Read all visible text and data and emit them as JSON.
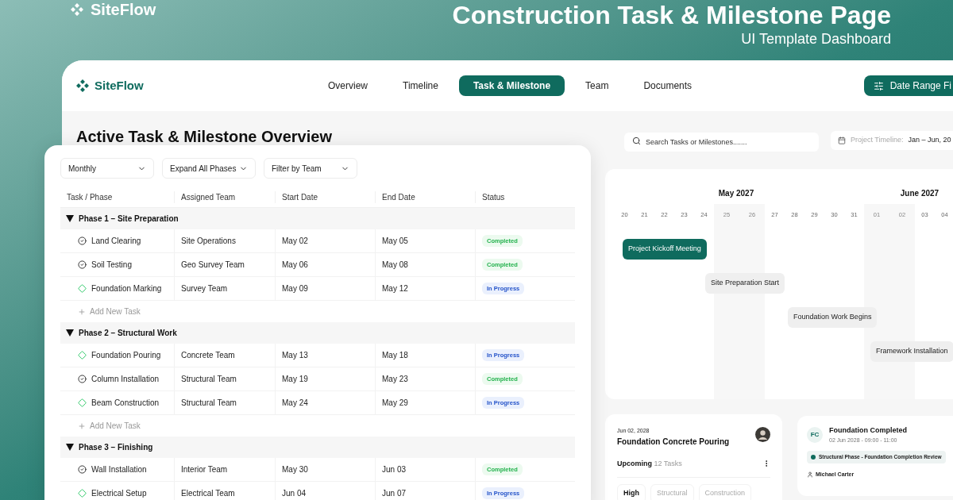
{
  "banner": {
    "brand": "SiteFlow",
    "title": "Construction Task & Milestone Page",
    "subtitle": "UI Template Dashboard"
  },
  "nav": {
    "brand": "SiteFlow",
    "tabs": [
      {
        "label": "Overview",
        "selected": false
      },
      {
        "label": "Timeline",
        "selected": false
      },
      {
        "label": "Task & Milestone",
        "selected": true
      },
      {
        "label": "Team",
        "selected": false
      },
      {
        "label": "Documents",
        "selected": false
      }
    ],
    "action": "Date Range Fi"
  },
  "page_title": "Active Task & Milestone Overview",
  "filters": [
    "Monthly",
    "Expand All Phases",
    "Filter by Team"
  ],
  "table": {
    "columns": [
      "Task / Phase",
      "Assigned Team",
      "Start Date",
      "End Date",
      "Status"
    ],
    "phases": [
      {
        "title": "Phase 1 – Site Preparation",
        "expanded": true,
        "add_label": "Add New Task",
        "tasks": [
          {
            "name": "Land Clearing",
            "team": "Site Operations",
            "start": "May 02",
            "end": "May 05",
            "status": {
              "text": "Completed",
              "kind": "completed"
            }
          },
          {
            "name": "Soil Testing",
            "team": "Geo Survey Team",
            "start": "May 06",
            "end": "May 08",
            "status": {
              "text": "Completed",
              "kind": "completed"
            }
          },
          {
            "name": "Foundation Marking",
            "team": "Survey Team",
            "start": "May 09",
            "end": "May 12",
            "status": {
              "text": "In Progress",
              "kind": "progress"
            }
          }
        ]
      },
      {
        "title": "Phase 2 – Structural Work",
        "expanded": true,
        "add_label": "Add New Task",
        "tasks": [
          {
            "name": "Foundation Pouring",
            "team": "Concrete Team",
            "start": "May 13",
            "end": "May 18",
            "status": {
              "text": "In Progress",
              "kind": "progress"
            }
          },
          {
            "name": "Column Installation",
            "team": "Structural Team",
            "start": "May 19",
            "end": "May 23",
            "status": {
              "text": "Completed",
              "kind": "completed"
            }
          },
          {
            "name": "Beam Construction",
            "team": "Structural Team",
            "start": "May 24",
            "end": "May 29",
            "status": {
              "text": "In Progress",
              "kind": "progress"
            }
          }
        ]
      },
      {
        "title": "Phase 3 – Finishing",
        "expanded": true,
        "tasks": [
          {
            "name": "Wall Installation",
            "team": "Interior Team",
            "start": "May 30",
            "end": "Jun 03",
            "status": {
              "text": "Completed",
              "kind": "completed"
            }
          },
          {
            "name": "Electrical Setup",
            "team": "Electrical Team",
            "start": "Jun 04",
            "end": "Jun 07",
            "status": {
              "text": "In Progress",
              "kind": "progress"
            }
          }
        ]
      }
    ]
  },
  "search": {
    "placeholder": "Search Tasks or Milestones......."
  },
  "project_timeline": {
    "label": "Project Timeline:",
    "value": "Jan – Jun, 20"
  },
  "timeline": {
    "months": [
      "May 2027",
      "June 2027"
    ],
    "days": [
      {
        "label": "20",
        "weekend": false
      },
      {
        "label": "21",
        "weekend": false
      },
      {
        "label": "22",
        "weekend": false
      },
      {
        "label": "23",
        "weekend": false
      },
      {
        "label": "24",
        "weekend": false
      },
      {
        "label": "25",
        "weekend": true
      },
      {
        "label": "26",
        "weekend": true
      },
      {
        "label": "27",
        "weekend": false
      },
      {
        "label": "28",
        "weekend": false
      },
      {
        "label": "29",
        "weekend": false
      },
      {
        "label": "30",
        "weekend": false
      },
      {
        "label": "31",
        "weekend": false
      },
      {
        "label": "01",
        "weekend": true
      },
      {
        "label": "02",
        "weekend": true
      },
      {
        "label": "03",
        "weekend": false
      },
      {
        "label": "04",
        "weekend": false
      }
    ],
    "events": [
      {
        "label": "Project Kickoff Meeting",
        "kind": "primary"
      },
      {
        "label": "Site Preparation Start",
        "kind": "plain"
      },
      {
        "label": "Foundation Work Begins",
        "kind": "plain"
      },
      {
        "label": "Framework Installation",
        "kind": "plain"
      }
    ]
  },
  "task_card": {
    "date": "Jun 02, 2028",
    "title": "Foundation Concrete Pouring",
    "status": "Upcoming",
    "count": "12 Tasks",
    "tags": [
      {
        "label": "High",
        "selected": true
      },
      {
        "label": "Structural",
        "selected": false
      },
      {
        "label": "Construction",
        "selected": false
      }
    ]
  },
  "milestone_card": {
    "initials": "FC",
    "title": "Foundation Completed",
    "time": "02 Jun 2028 - 09:00 - 11:00",
    "phase": {
      "label": "Structural Phase - Foundation Completion Review",
      "color": "#0f6b5c"
    },
    "owner": "Michael Carter"
  }
}
